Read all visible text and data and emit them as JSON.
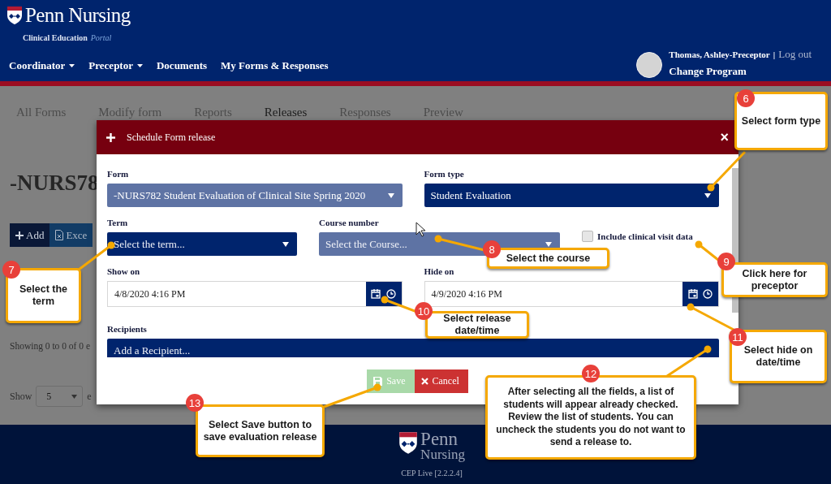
{
  "header": {
    "brand": "Penn Nursing",
    "subtitle": "Clinical Education",
    "subtitle_accent": "Portal",
    "nav": [
      {
        "label": "Coordinator",
        "dropdown": true
      },
      {
        "label": "Preceptor",
        "dropdown": true
      },
      {
        "label": "Documents",
        "dropdown": false
      },
      {
        "label": "My Forms & Responses",
        "dropdown": false
      }
    ],
    "user": {
      "name": "Thomas, Ashley-Preceptor",
      "separator": "|",
      "logout": "Log out",
      "change_program": "Change Program"
    }
  },
  "page": {
    "tabs": [
      {
        "label": "All Forms",
        "selected": false
      },
      {
        "label": "Modify form",
        "selected": false
      },
      {
        "label": "Reports",
        "selected": false
      },
      {
        "label": "Releases",
        "selected": true
      },
      {
        "label": "Responses",
        "selected": false
      },
      {
        "label": "Preview",
        "selected": false
      }
    ],
    "heading": "-NURS78",
    "toolbar": [
      {
        "label": "Add",
        "kind": "add"
      },
      {
        "label": "Exce",
        "kind": "excel"
      }
    ],
    "info": "Showing 0 to 0 of 0 e",
    "length": {
      "label": "Show",
      "value": "5",
      "suffix": "e"
    }
  },
  "modal": {
    "title": "Schedule Form release",
    "close": "×",
    "rows": [
      [
        {
          "kind": "select",
          "label": "Form",
          "value": "-NURS782 Student Evaluation of Clinical Site Spring 2020",
          "disabled": true
        },
        {
          "kind": "select",
          "label": "Form type",
          "value": "Student Evaluation",
          "disabled": false
        }
      ],
      [
        {
          "kind": "select",
          "label": "Term",
          "placeholder": "Select the term...",
          "disabled": false
        },
        {
          "kind": "select",
          "label": "Course number",
          "placeholder": "Select the Course...",
          "disabled": true
        },
        {
          "kind": "checkbox",
          "label": "Include clinical visit data",
          "checked": false
        }
      ],
      [
        {
          "kind": "datetime",
          "label": "Show on",
          "value": "4/8/2020 4:16 PM"
        },
        {
          "kind": "datetime",
          "label": "Hide on",
          "value": "4/9/2020 4:16 PM"
        }
      ],
      [
        {
          "kind": "select",
          "label": "Recipients",
          "placeholder": "Add a Recipient...",
          "disabled": false
        }
      ]
    ],
    "buttons": [
      {
        "label": "Save",
        "kind": "save",
        "disabled": true
      },
      {
        "label": "Cancel",
        "kind": "cancel",
        "disabled": false
      }
    ]
  },
  "callouts": [
    {
      "number": "6",
      "text": "Select form type"
    },
    {
      "number": "7",
      "text": "Select the term"
    },
    {
      "number": "8",
      "text": "Select the course"
    },
    {
      "number": "9",
      "text": "Click here for preceptor"
    },
    {
      "number": "10",
      "text": "Select release date/time"
    },
    {
      "number": "11",
      "text": "Select hide on date/time"
    },
    {
      "number": "12",
      "text": "After selecting all the fields, a list of students will appear already checked. Review the list of students. You can uncheck the students you do not want to send a release to."
    },
    {
      "number": "13",
      "text": "Select Save button to save evaluation release"
    }
  ],
  "footer": {
    "brand_line1": "Penn",
    "brand_line2": "Nursing",
    "version": "CEP Live [2.2.2.4]"
  }
}
